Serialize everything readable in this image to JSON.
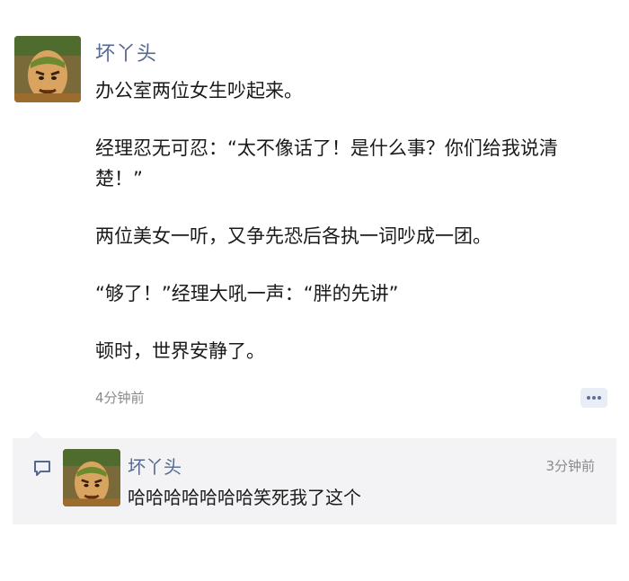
{
  "post": {
    "author": "坏丫头",
    "paragraphs": [
      "办公室两位女生吵起来。",
      "经理忍无可忍：“太不像话了！是什么事？你们给我说清楚！”",
      "两位美女一听，又争先恐后各执一词吵成一团。",
      "“够了！”经理大吼一声：“胖的先讲”",
      "顿时，世界安静了。"
    ],
    "time": "4分钟前",
    "action_icon": "comment-bubble-dots-icon"
  },
  "comments": [
    {
      "author": "坏丫头",
      "time": "3分钟前",
      "text": "哈哈哈哈哈哈哈笑死我了这个"
    }
  ],
  "colors": {
    "name": "#55688f",
    "text": "#1a1a1a",
    "muted": "#8a8a8a",
    "comment_bg": "#f3f3f5",
    "action_bg": "#e9edf5"
  }
}
